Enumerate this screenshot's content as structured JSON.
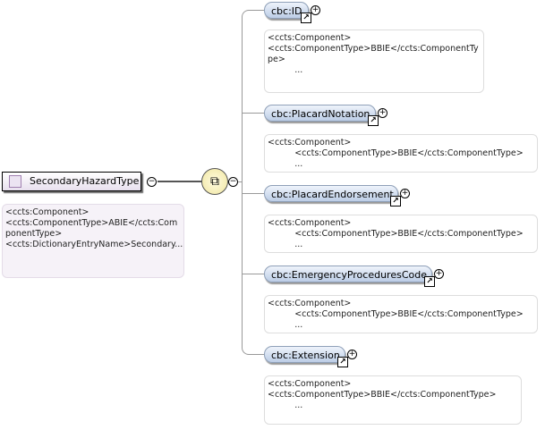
{
  "root": {
    "name": "SecondaryHazardType",
    "annotation": [
      "<ccts:Component>",
      "",
      "<ccts:ComponentType>ABIE</ccts:Com",
      "ponentType>",
      "",
      "<ccts:DictionaryEntryName>Secondary..."
    ]
  },
  "icons": {
    "collapse": "minus-circle",
    "expand": "plus-circle",
    "sequence": "sequence-compositor",
    "reference": "reference-arrow"
  },
  "elements": [
    {
      "name": "cbc:ID",
      "annotation": [
        "<ccts:Component>",
        "",
        "<ccts:ComponentType>BBIE</ccts:ComponentTy",
        "pe>",
        "          ..."
      ]
    },
    {
      "name": "cbc:PlacardNotation",
      "annotation": [
        "<ccts:Component>",
        "          <ccts:ComponentType>BBIE</ccts:ComponentType>",
        "          ..."
      ]
    },
    {
      "name": "cbc:PlacardEndorsement",
      "annotation": [
        "<ccts:Component>",
        "          <ccts:ComponentType>BBIE</ccts:ComponentType>",
        "          ..."
      ]
    },
    {
      "name": "cbc:EmergencyProceduresCode",
      "annotation": [
        "<ccts:Component>",
        "          <ccts:ComponentType>BBIE</ccts:ComponentType>",
        "          ..."
      ]
    },
    {
      "name": "cbc:Extension",
      "annotation": [
        "<ccts:Component>",
        "",
        "<ccts:ComponentType>BBIE</ccts:ComponentType>",
        "          ..."
      ]
    }
  ]
}
